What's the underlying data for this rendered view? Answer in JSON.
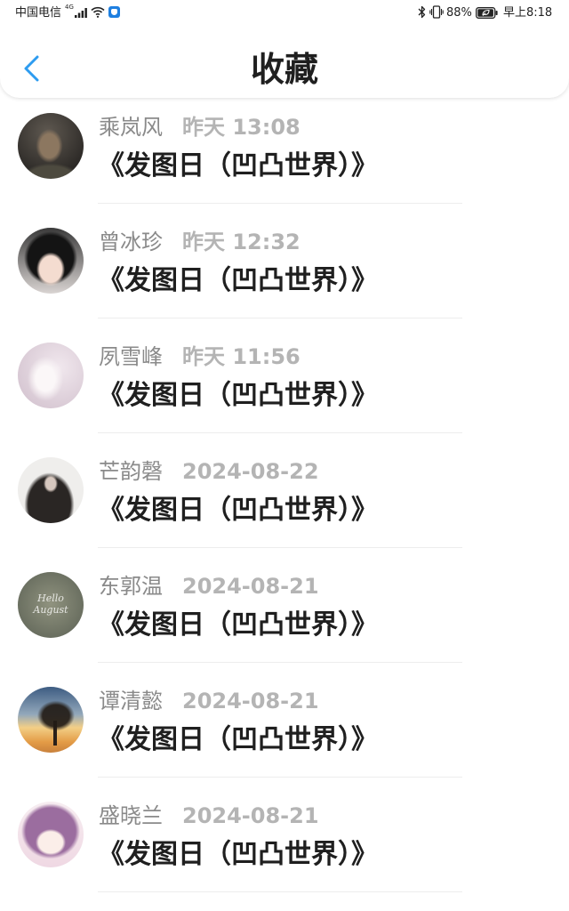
{
  "status_bar": {
    "carrier": "中国电信",
    "network_type": "4G",
    "icons": [
      "signal-icon",
      "wifi-icon",
      "app-notification-icon",
      "bluetooth-icon",
      "vibrate-icon",
      "battery-icon"
    ],
    "battery_level": "88%",
    "time": "早上8:18"
  },
  "header": {
    "back_icon": "chevron-left-icon",
    "title": "收藏"
  },
  "colors": {
    "accent": "#2d9cf0",
    "title_text": "#1f1f1f",
    "author_text": "#8a8a8a",
    "time_text": "#b4b4b4",
    "divider": "#ededed",
    "background": "#ffffff"
  },
  "favorites": [
    {
      "author": "乘岚风",
      "time": "昨天 13:08",
      "title": "《发图日（凹凸世界）》"
    },
    {
      "author": "曾冰珍",
      "time": "昨天 12:32",
      "title": "《发图日（凹凸世界）》"
    },
    {
      "author": "夙雪峰",
      "time": "昨天 11:56",
      "title": "《发图日（凹凸世界）》"
    },
    {
      "author": "芒韵磬",
      "time": "2024-08-22",
      "title": "《发图日（凹凸世界）》"
    },
    {
      "author": "东郭温",
      "time": "2024-08-21",
      "title": "《发图日（凹凸世界）》",
      "avatar_caption": [
        "Hello",
        "August"
      ]
    },
    {
      "author": "谭清懿",
      "time": "2024-08-21",
      "title": "《发图日（凹凸世界）》"
    },
    {
      "author": "盛晓兰",
      "time": "2024-08-21",
      "title": "《发图日（凹凸世界）》"
    }
  ]
}
